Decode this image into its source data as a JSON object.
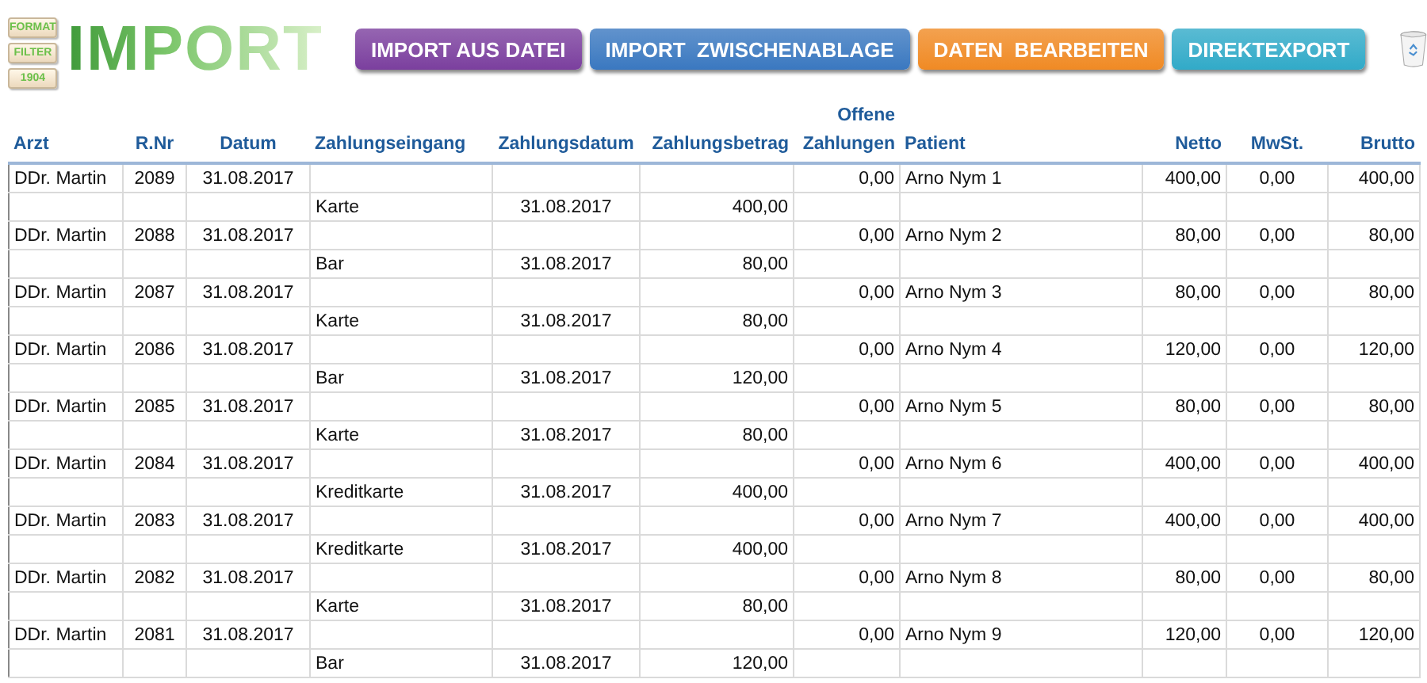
{
  "side_buttons": [
    "FORMAT",
    "FILTER",
    "1904"
  ],
  "logo": "IMPORT",
  "actions": [
    {
      "label": "IMPORT AUS DATEI",
      "color": "#7b3f9e"
    },
    {
      "label": "IMPORT  ZWISCHENABLAGE",
      "color": "#3a78c0"
    },
    {
      "label": "DATEN  BEARBEITEN",
      "color": "#f08a24"
    },
    {
      "label": "DIREKTEXPORT",
      "color": "#31aac8"
    }
  ],
  "table": {
    "columns": [
      "Arzt",
      "R.Nr",
      "Datum",
      "Zahlungseingang",
      "Zahlungsdatum",
      "Zahlungsbetrag",
      "Offene Zahlungen",
      "Patient",
      "Netto",
      "MwSt.",
      "Brutto"
    ],
    "invoices": [
      {
        "arzt": "DDr. Martin",
        "nr": "2089",
        "datum": "31.08.2017",
        "offene": "0,00",
        "patient": "Arno Nym 1",
        "netto": "400,00",
        "mwst": "0,00",
        "brutto": "400,00",
        "payment": {
          "eingang": "Karte",
          "datum": "31.08.2017",
          "betrag": "400,00"
        }
      },
      {
        "arzt": "DDr. Martin",
        "nr": "2088",
        "datum": "31.08.2017",
        "offene": "0,00",
        "patient": "Arno Nym 2",
        "netto": "80,00",
        "mwst": "0,00",
        "brutto": "80,00",
        "payment": {
          "eingang": "Bar",
          "datum": "31.08.2017",
          "betrag": "80,00"
        }
      },
      {
        "arzt": "DDr. Martin",
        "nr": "2087",
        "datum": "31.08.2017",
        "offene": "0,00",
        "patient": "Arno Nym 3",
        "netto": "80,00",
        "mwst": "0,00",
        "brutto": "80,00",
        "payment": {
          "eingang": "Karte",
          "datum": "31.08.2017",
          "betrag": "80,00"
        }
      },
      {
        "arzt": "DDr. Martin",
        "nr": "2086",
        "datum": "31.08.2017",
        "offene": "0,00",
        "patient": "Arno Nym 4",
        "netto": "120,00",
        "mwst": "0,00",
        "brutto": "120,00",
        "payment": {
          "eingang": "Bar",
          "datum": "31.08.2017",
          "betrag": "120,00"
        }
      },
      {
        "arzt": "DDr. Martin",
        "nr": "2085",
        "datum": "31.08.2017",
        "offene": "0,00",
        "patient": "Arno Nym 5",
        "netto": "80,00",
        "mwst": "0,00",
        "brutto": "80,00",
        "payment": {
          "eingang": "Karte",
          "datum": "31.08.2017",
          "betrag": "80,00"
        }
      },
      {
        "arzt": "DDr. Martin",
        "nr": "2084",
        "datum": "31.08.2017",
        "offene": "0,00",
        "patient": "Arno Nym 6",
        "netto": "400,00",
        "mwst": "0,00",
        "brutto": "400,00",
        "payment": {
          "eingang": "Kreditkarte",
          "datum": "31.08.2017",
          "betrag": "400,00"
        }
      },
      {
        "arzt": "DDr. Martin",
        "nr": "2083",
        "datum": "31.08.2017",
        "offene": "0,00",
        "patient": "Arno Nym 7",
        "netto": "400,00",
        "mwst": "0,00",
        "brutto": "400,00",
        "payment": {
          "eingang": "Kreditkarte",
          "datum": "31.08.2017",
          "betrag": "400,00"
        }
      },
      {
        "arzt": "DDr. Martin",
        "nr": "2082",
        "datum": "31.08.2017",
        "offene": "0,00",
        "patient": "Arno Nym 8",
        "netto": "80,00",
        "mwst": "0,00",
        "brutto": "80,00",
        "payment": {
          "eingang": "Karte",
          "datum": "31.08.2017",
          "betrag": "80,00"
        }
      },
      {
        "arzt": "DDr. Martin",
        "nr": "2081",
        "datum": "31.08.2017",
        "offene": "0,00",
        "patient": "Arno Nym 9",
        "netto": "120,00",
        "mwst": "0,00",
        "brutto": "120,00",
        "payment": {
          "eingang": "Bar",
          "datum": "31.08.2017",
          "betrag": "120,00"
        }
      }
    ]
  }
}
